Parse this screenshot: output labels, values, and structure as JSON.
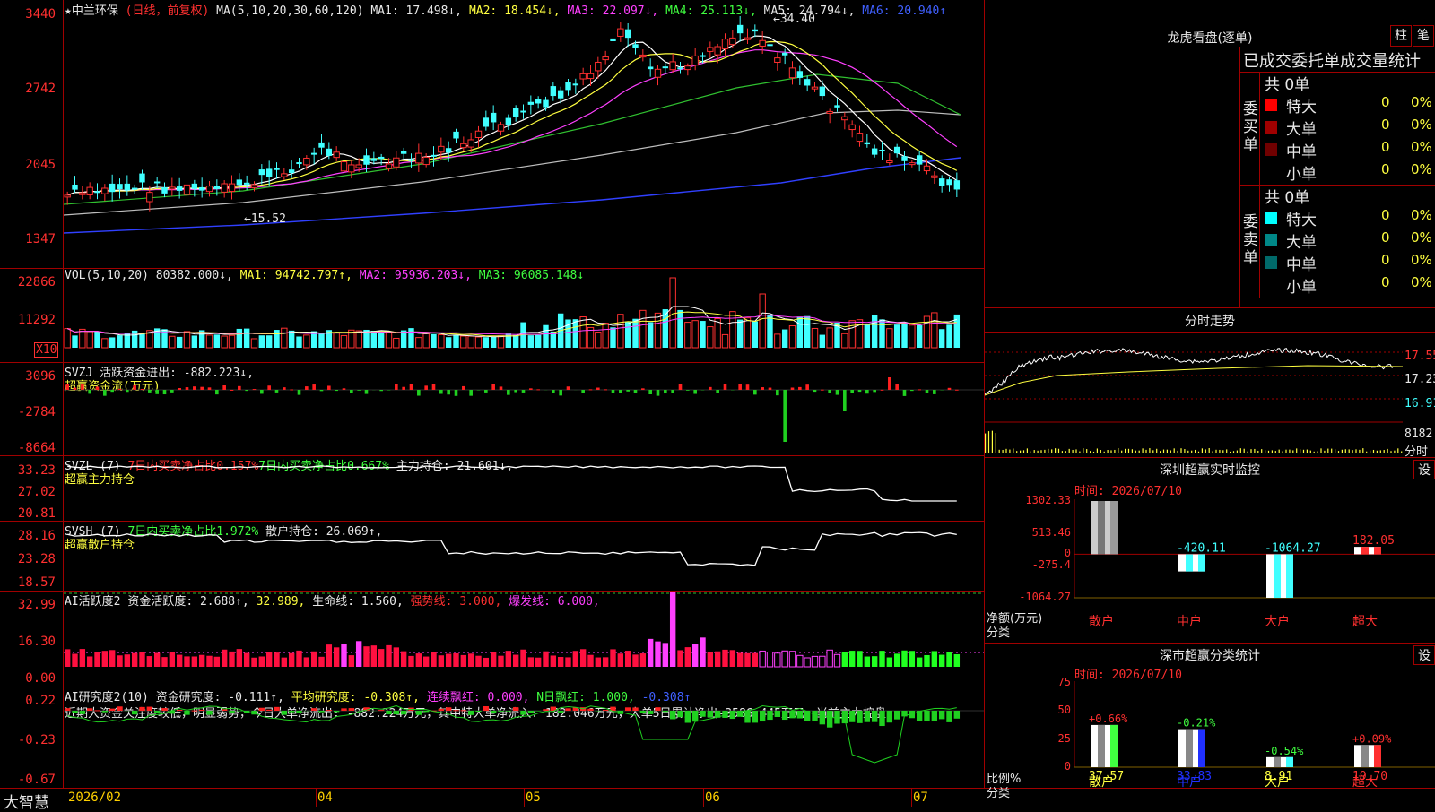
{
  "main": {
    "yaxis": [
      "3440",
      "2742",
      "2045",
      "1347"
    ],
    "header": {
      "star": "★",
      "stock_name": "中兰环保",
      "period": "(日线，前复权)",
      "ma_label": "MA(5,10,20,30,60,120)",
      "ma1": "MA1: 17.498↓,",
      "ma2": "MA2: 18.454↓,",
      "ma3": "MA3: 22.097↓,",
      "ma4": "MA4: 25.113↓,",
      "ma5": "MA5: 24.794↓,",
      "ma6": "MA6: 20.940↑"
    },
    "high_label": "34.40",
    "low_label": "15.52"
  },
  "vol": {
    "yaxis": [
      "22866",
      "11292"
    ],
    "unit": "X10",
    "label": "VOL(5,10,20)",
    "value": "80382.000↓,",
    "ma1": "MA1: 94742.797↑,",
    "ma2": "MA2: 95936.203↓,",
    "ma3": "MA3: 96085.148↓"
  },
  "svzj": {
    "yaxis": [
      "3096",
      "-2784",
      "-8664"
    ],
    "label": "SVZJ",
    "value": "活跃资金进出: -882.223↓,",
    "sub": "超赢资金流(万元)"
  },
  "svzl": {
    "yaxis": [
      "33.23",
      "27.02",
      "20.81"
    ],
    "label": "SVZL (7)",
    "t1": "7日内买卖净占比0.157%",
    "t2": "7日内买卖净占比0.667%",
    "t3": "主力持仓: 21.601↓,",
    "sub": "超赢主力持仓"
  },
  "svsh": {
    "yaxis": [
      "28.16",
      "23.28",
      "18.57"
    ],
    "label": "SVSH (7)",
    "t1": "7日内买卖净占比1.972%",
    "t2": "散户持仓: 26.069↑,",
    "sub": "超赢散户持仓"
  },
  "ai1": {
    "yaxis": [
      "32.99",
      "16.30",
      "0.00"
    ],
    "label": "AI活跃度2",
    "t1": "资金活跃度: 2.688↑,",
    "t2": "32.989,",
    "t3": "生命线: 1.560,",
    "t4": "强势线: 3.000,",
    "t5": "爆发线: 6.000,"
  },
  "ai2": {
    "yaxis": [
      "0.22",
      "-0.23",
      "-0.67"
    ],
    "label": "AI研究度2(10)",
    "t1": "资金研究度: -0.111↑,",
    "t2": "平均研究度: -0.308↑,",
    "t3": "连续飘红: 0.000,",
    "t4": "N日飘红: 1.000,",
    "t5": "-0.308↑",
    "summary": "近期大资金关注度较低，明显弱势，今日大单净流出: -882.224万元，其中特大单净流入: 182.046万元，大单5日累计净出-3586.445万元，当前主力控盘"
  },
  "xaxis": {
    "brand": "大智慧",
    "labels": [
      "2026/02",
      "04",
      "05",
      "06",
      "07"
    ]
  },
  "lhb": {
    "title": "龙虎看盘(逐单)",
    "btn_zhu": "柱",
    "btn_bi": "笔",
    "tabs": "已成交委托单成交量统计",
    "buy_side": "委买单",
    "sell_side": "委卖单",
    "buy_total": "共 0单",
    "sell_total": "共 0单",
    "buy_rows": [
      {
        "name": "特大",
        "count": "0",
        "pct": "0%",
        "color": "#ff0000"
      },
      {
        "name": "大单",
        "count": "0",
        "pct": "0%",
        "color": "#a00000"
      },
      {
        "name": "中单",
        "count": "0",
        "pct": "0%",
        "color": "#700000"
      },
      {
        "name": "小单",
        "count": "0",
        "pct": "0%",
        "color": "#000000"
      }
    ],
    "sell_rows": [
      {
        "name": "特大",
        "count": "0",
        "pct": "0%",
        "color": "#00ffff"
      },
      {
        "name": "大单",
        "count": "0",
        "pct": "0%",
        "color": "#008888"
      },
      {
        "name": "中单",
        "count": "0",
        "pct": "0%",
        "color": "#006a6a"
      },
      {
        "name": "小单",
        "count": "0",
        "pct": "0%",
        "color": "#000000"
      }
    ]
  },
  "intraday": {
    "title": "分时走势",
    "p1": "17.55",
    "p2": "17.23",
    "p3": "16.91",
    "vol": "8182",
    "unit": "分时"
  },
  "szmon": {
    "title": "深圳超赢实时监控",
    "btn": "设",
    "time": "时间: 2026/07/10",
    "yaxis": [
      "1302.33",
      "513.46",
      "0",
      "-275.4",
      "-1064.27"
    ],
    "bars": [
      {
        "cat": "散户",
        "value": 1302.33,
        "label": "1302.33"
      },
      {
        "cat": "中户",
        "value": -420.11,
        "label": "-420.11"
      },
      {
        "cat": "大户",
        "value": -1064.27,
        "label": "-1064.27"
      },
      {
        "cat": "超大",
        "value": 182.05,
        "label": "182.05"
      }
    ],
    "ylabel": "净额(万元)",
    "xlabel": "分类"
  },
  "szcls": {
    "title": "深市超赢分类统计",
    "btn": "设",
    "time": "时间: 2026/07/10",
    "yaxis": [
      "75",
      "50",
      "25",
      "0"
    ],
    "bars": [
      {
        "cat": "散户",
        "value": 37.57,
        "label": "37.57",
        "chg": "+0.66%"
      },
      {
        "cat": "中户",
        "value": 33.83,
        "label": "33.83",
        "chg": "-0.21%"
      },
      {
        "cat": "大户",
        "value": 8.91,
        "label": "8.91",
        "chg": "-0.54%"
      },
      {
        "cat": "超大",
        "value": 19.7,
        "label": "19.70",
        "chg": "+0.09%"
      }
    ],
    "ylabel": "比例%",
    "xlabel": "分类"
  },
  "chart_data": [
    {
      "type": "candlestick",
      "title": "中兰环保 (日线，前复权)",
      "ylim": [
        1347,
        3440
      ],
      "annotations": [
        "34.40",
        "15.52"
      ]
    },
    {
      "type": "bar",
      "title": "深圳超赢实时监控",
      "categories": [
        "散户",
        "中户",
        "大户",
        "超大"
      ],
      "values": [
        1302.33,
        -420.11,
        -1064.27,
        182.05
      ],
      "ylabel": "净额(万元)",
      "xlabel": "分类",
      "ylim": [
        -1064.27,
        1302.33
      ]
    },
    {
      "type": "bar",
      "title": "深市超赢分类统计",
      "categories": [
        "散户",
        "中户",
        "大户",
        "超大"
      ],
      "values": [
        37.57,
        33.83,
        8.91,
        19.7
      ],
      "ylabel": "比例%",
      "xlabel": "分类",
      "ylim": [
        0,
        75
      ]
    }
  ]
}
